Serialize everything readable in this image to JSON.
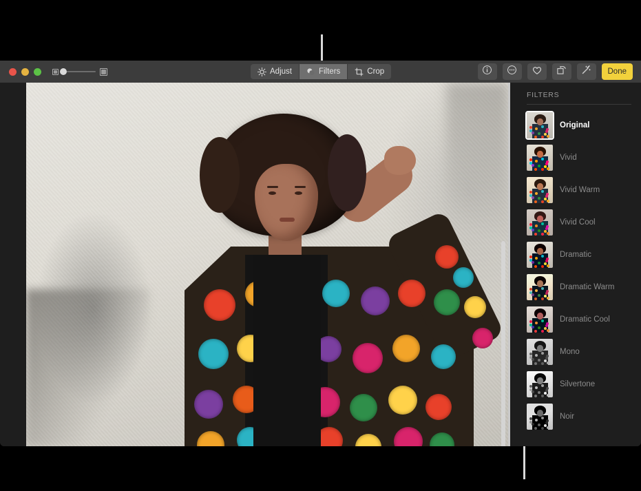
{
  "window": {
    "traffic_lights": [
      {
        "name": "close",
        "color": "#e9544a"
      },
      {
        "name": "minimize",
        "color": "#e5b341"
      },
      {
        "name": "maximize",
        "color": "#5cc246"
      }
    ]
  },
  "toolbar": {
    "zoom_slider": {
      "small_icon": "small-photo-icon",
      "large_icon": "large-photo-icon",
      "value": 18
    },
    "segments": [
      {
        "label": "Adjust",
        "icon": "adjust-icon",
        "active": false
      },
      {
        "label": "Filters",
        "icon": "filters-icon",
        "active": true
      },
      {
        "label": "Crop",
        "icon": "crop-icon",
        "active": false
      }
    ],
    "right_buttons": [
      {
        "name": "info-button",
        "icon": "info-circle-icon"
      },
      {
        "name": "more-button",
        "icon": "ellipsis-circle-icon"
      },
      {
        "name": "favorite-button",
        "icon": "heart-icon"
      },
      {
        "name": "rotate-button",
        "icon": "rotate-icon"
      },
      {
        "name": "enhance-button",
        "icon": "magic-wand-icon"
      }
    ],
    "done_label": "Done"
  },
  "sidebar": {
    "title": "FILTERS",
    "filters": [
      {
        "label": "Original",
        "selected": true,
        "tint": "none"
      },
      {
        "label": "Vivid",
        "selected": false,
        "tint": "vivid"
      },
      {
        "label": "Vivid Warm",
        "selected": false,
        "tint": "vivid-warm"
      },
      {
        "label": "Vivid Cool",
        "selected": false,
        "tint": "vivid-cool"
      },
      {
        "label": "Dramatic",
        "selected": false,
        "tint": "dramatic"
      },
      {
        "label": "Dramatic Warm",
        "selected": false,
        "tint": "dramatic-warm"
      },
      {
        "label": "Dramatic Cool",
        "selected": false,
        "tint": "dramatic-cool"
      },
      {
        "label": "Mono",
        "selected": false,
        "tint": "mono"
      },
      {
        "label": "Silvertone",
        "selected": false,
        "tint": "silvertone"
      },
      {
        "label": "Noir",
        "selected": false,
        "tint": "noir"
      }
    ]
  },
  "canvas": {
    "photo_description": "Portrait of a person with curly hair wearing a colorful embroidered jacket against a white textured wall",
    "scrollbar": "vertical-scrollbar"
  },
  "callouts": [
    {
      "name": "callout-line-filters",
      "target": "Filters"
    },
    {
      "name": "callout-line-sidebar",
      "target": "Filters sidebar"
    }
  ],
  "colors": {
    "toolbar_bg": "#3c3c3c",
    "sidebar_bg": "#1e1e1e",
    "done_bg": "#f2d13c",
    "selected_text": "#ffffff",
    "label_text": "#8c8c8c"
  }
}
